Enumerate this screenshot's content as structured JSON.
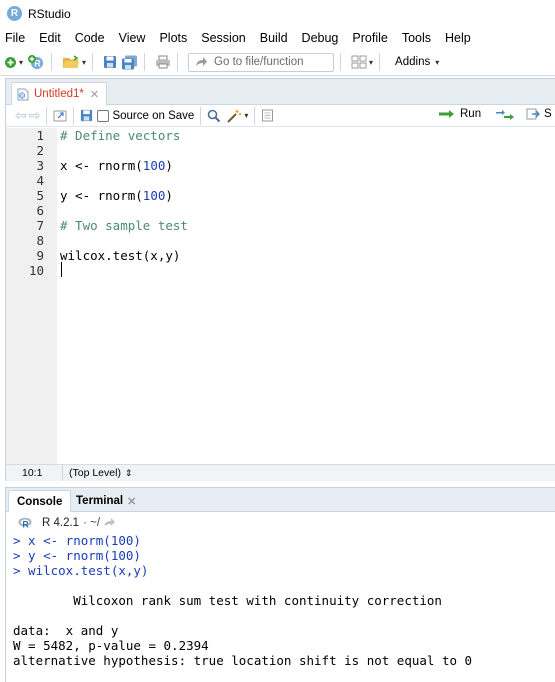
{
  "window": {
    "title": "RStudio",
    "logo_letter": "R"
  },
  "menu": [
    "File",
    "Edit",
    "Code",
    "View",
    "Plots",
    "Session",
    "Build",
    "Debug",
    "Profile",
    "Tools",
    "Help"
  ],
  "toolbar": {
    "goto_placeholder": "Go to file/function",
    "addins_label": "Addins"
  },
  "editor": {
    "tab_label": "Untitled1*",
    "source_on_save_label": "Source on Save",
    "run_label": "Run",
    "source_label": "S",
    "line_numbers": [
      "1",
      "2",
      "3",
      "4",
      "5",
      "6",
      "7",
      "8",
      "9",
      "10"
    ],
    "lines": [
      "# Define vectors",
      "",
      "x <- rnorm(100)",
      "",
      "y <- rnorm(100)",
      "",
      "# Two sample test",
      "",
      "wilcox.test(x,y)",
      ""
    ],
    "code_parts": {
      "l1": "# Define vectors",
      "l3a": "x <- rnorm(",
      "l3b": "100",
      "l3c": ")",
      "l5a": "y <- rnorm(",
      "l5b": "100",
      "l5c": ")",
      "l7": "# Two sample test",
      "l9": "wilcox.test(x,y)"
    },
    "status": {
      "cursor_position": "10:1",
      "scope": "(Top Level)",
      "scope_arrow": "⇕"
    }
  },
  "console": {
    "tabs": [
      "Console",
      "Terminal"
    ],
    "r_version": "R 4.2.1",
    "working_dir": "· ~/",
    "lines": [
      {
        "kind": "input",
        "text": "> x <- rnorm(100)"
      },
      {
        "kind": "input",
        "text": "> y <- rnorm(100)"
      },
      {
        "kind": "input",
        "text": "> wilcox.test(x,y)"
      },
      {
        "kind": "output",
        "text": ""
      },
      {
        "kind": "output",
        "text": "\tWilcoxon rank sum test with continuity correction"
      },
      {
        "kind": "output",
        "text": ""
      },
      {
        "kind": "output",
        "text": "data:  x and y"
      },
      {
        "kind": "output",
        "text": "W = 5482, p-value = 0.2394"
      },
      {
        "kind": "output",
        "text": "alternative hypothesis: true location shift is not equal to 0"
      }
    ],
    "display_lines": {
      "c1": "> x <- rnorm(100)",
      "c2": "> y <- rnorm(100)",
      "c3": "> wilcox.test(x,y)",
      "c5": "        Wilcoxon rank sum test with continuity correction",
      "c7": "data:  x and y",
      "c8": "W = 5482, p-value = 0.2394",
      "c9": "alternative hypothesis: true location shift is not equal to 0"
    }
  },
  "colors": {
    "accent_blue": "#75aadb",
    "comment_green": "#4a8a73",
    "number_blue": "#1a3db8",
    "tab_modified_red": "#d13a1f"
  }
}
